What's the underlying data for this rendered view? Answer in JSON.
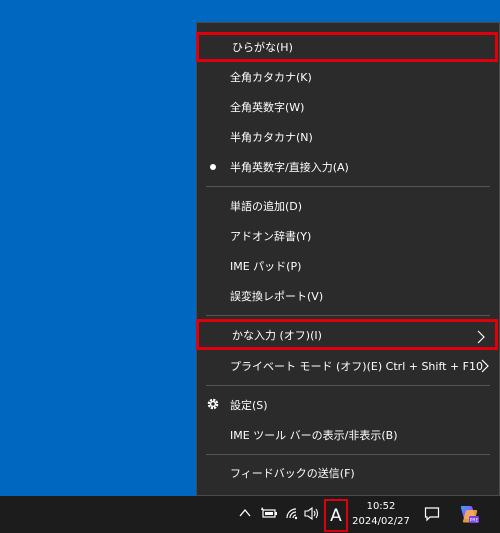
{
  "menu": {
    "items": [
      {
        "label": "ひらがな(H)"
      },
      {
        "label": "全角カタカナ(K)"
      },
      {
        "label": "全角英数字(W)"
      },
      {
        "label": "半角カタカナ(N)"
      },
      {
        "label": "半角英数字/直接入力(A)"
      },
      {
        "label": "単語の追加(D)"
      },
      {
        "label": "アドオン辞書(Y)"
      },
      {
        "label": "IME パッド(P)"
      },
      {
        "label": "誤変換レポート(V)"
      },
      {
        "label": "かな入力 (オフ)(I)"
      },
      {
        "label": "プライベート モード (オフ)(E)",
        "shortcut": "Ctrl + Shift + F10"
      },
      {
        "label": "設定(S)"
      },
      {
        "label": "IME ツール バーの表示/非表示(B)"
      },
      {
        "label": "フィードバックの送信(F)"
      }
    ]
  },
  "taskbar": {
    "ime_indicator": "A",
    "time": "10:52",
    "date": "2024/02/27"
  },
  "colors": {
    "desktop": "#0067c0",
    "menu_bg": "#2b2b2b",
    "highlight_border": "#e0000b"
  }
}
